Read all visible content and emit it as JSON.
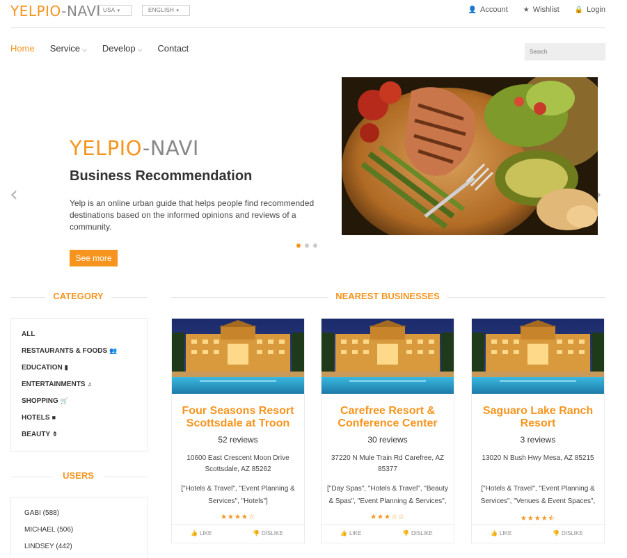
{
  "brand": {
    "part1": "YELPIO",
    "part2": "-NAVI"
  },
  "top_selects": {
    "country": "USA",
    "language": "ENGLISH"
  },
  "top_links": [
    {
      "icon": "user-icon",
      "glyph": "👤",
      "label": "Account"
    },
    {
      "icon": "star-icon",
      "glyph": "★",
      "label": "Wishlist"
    },
    {
      "icon": "lock-icon",
      "glyph": "🔒",
      "label": "Login"
    }
  ],
  "nav": [
    {
      "label": "Home",
      "dropdown": false,
      "active": true
    },
    {
      "label": "Service",
      "dropdown": true,
      "active": false
    },
    {
      "label": "Develop",
      "dropdown": true,
      "active": false
    },
    {
      "label": "Contact",
      "dropdown": false,
      "active": false
    }
  ],
  "search": {
    "placeholder": "Search"
  },
  "hero": {
    "title_part1": "YELPIO",
    "title_part2": "-NAVI",
    "subtitle": "Business Recommendation",
    "text": "Yelp is an online urban guide that helps people find recommended destinations based on the informed opinions and reviews of a community.",
    "button": "See more",
    "prev_glyph": "‹",
    "next_glyph": "›",
    "slide_count": 3,
    "active_slide": 1
  },
  "category": {
    "heading": "CATEGORY",
    "items": [
      {
        "label": "ALL",
        "icon": "",
        "glyph": ""
      },
      {
        "label": "RESTAURANTS & FOODS",
        "icon": "group-icon",
        "glyph": "👥"
      },
      {
        "label": "EDUCATION",
        "icon": "book-icon",
        "glyph": "▮"
      },
      {
        "label": "ENTERTAINMENTS",
        "icon": "music-icon",
        "glyph": "♫"
      },
      {
        "label": "SHOPPING",
        "icon": "cart-icon",
        "glyph": "🛒"
      },
      {
        "label": "HOTELS",
        "icon": "briefcase-icon",
        "glyph": "■"
      },
      {
        "label": "BEAUTY",
        "icon": "flask-icon",
        "glyph": "⚱"
      }
    ]
  },
  "users": {
    "heading": "USERS",
    "items": [
      {
        "label": "GABI (588)"
      },
      {
        "label": "MICHAEL (506)"
      },
      {
        "label": "LINDSEY (442)"
      }
    ]
  },
  "nearest": {
    "heading": "NEAREST BUSINESSES",
    "like_label": "LIKE",
    "dislike_label": "DISLIKE",
    "businesses": [
      {
        "name": "Four Seasons Resort Scottsdale at Troon",
        "reviews": "52 reviews",
        "address": "10600 East Crescent Moon Drive Scottsdale, AZ 85262",
        "categories": "[\"Hotels & Travel\", \"Event Planning & Services\", \"Hotels\"]",
        "rating": 4.0
      },
      {
        "name": "Carefree Resort & Conference Center",
        "reviews": "30 reviews",
        "address": "37220 N Mule Train Rd Carefree, AZ 85377",
        "categories": "[\"Day Spas\", \"Hotels & Travel\", \"Beauty & Spas\", \"Event Planning & Services\",",
        "rating": 3.0
      },
      {
        "name": "Saguaro Lake Ranch Resort",
        "reviews": "3 reviews",
        "address": "13020 N Bush Hwy Mesa, AZ 85215",
        "categories": "[\"Hotels & Travel\", \"Event Planning & Services\", \"Venues & Event Spaces\",",
        "rating": 4.5
      }
    ]
  },
  "colors": {
    "accent": "#f7941d",
    "muted": "#888888",
    "border": "#ececec"
  }
}
